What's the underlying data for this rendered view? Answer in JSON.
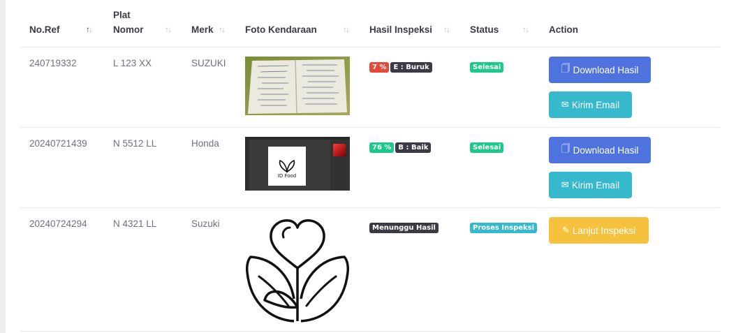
{
  "columns": {
    "no_ref": "No.Ref",
    "plat_nomor_1": "Plat",
    "plat_nomor_2": "Nomor",
    "merk": "Merk",
    "foto": "Foto Kendaraan",
    "hasil": "Hasil Inspeksi",
    "status": "Status",
    "action": "Action"
  },
  "rows": [
    {
      "no_ref": "240719332",
      "plat": "L 123 XX",
      "merk": "SUZUKI",
      "score": "7 %",
      "grade": "E : Buruk",
      "status": "Selesai",
      "btn_download": "Download Hasil",
      "btn_email": "Kirim Email"
    },
    {
      "no_ref": "20240721439",
      "plat": "N 5512 LL",
      "merk": "Honda",
      "score": "76 %",
      "grade": "B : Baik",
      "status": "Selesai",
      "btn_download": "Download Hasil",
      "btn_email": "Kirim Email",
      "photo_caption": "ID Food"
    },
    {
      "no_ref": "20240724294",
      "plat": "N 4321 LL",
      "merk": "Suzuki",
      "hasil": "Menunggu Hasil",
      "status": "Proses Inspeksi",
      "btn_continue": "Lanjut Inspeksi"
    }
  ],
  "colors": {
    "primary": "#4e73df",
    "info": "#36b9cc",
    "success": "#1cc88a",
    "danger": "#e74a3b",
    "warning": "#f6c23e",
    "dark": "#3a3b45"
  }
}
